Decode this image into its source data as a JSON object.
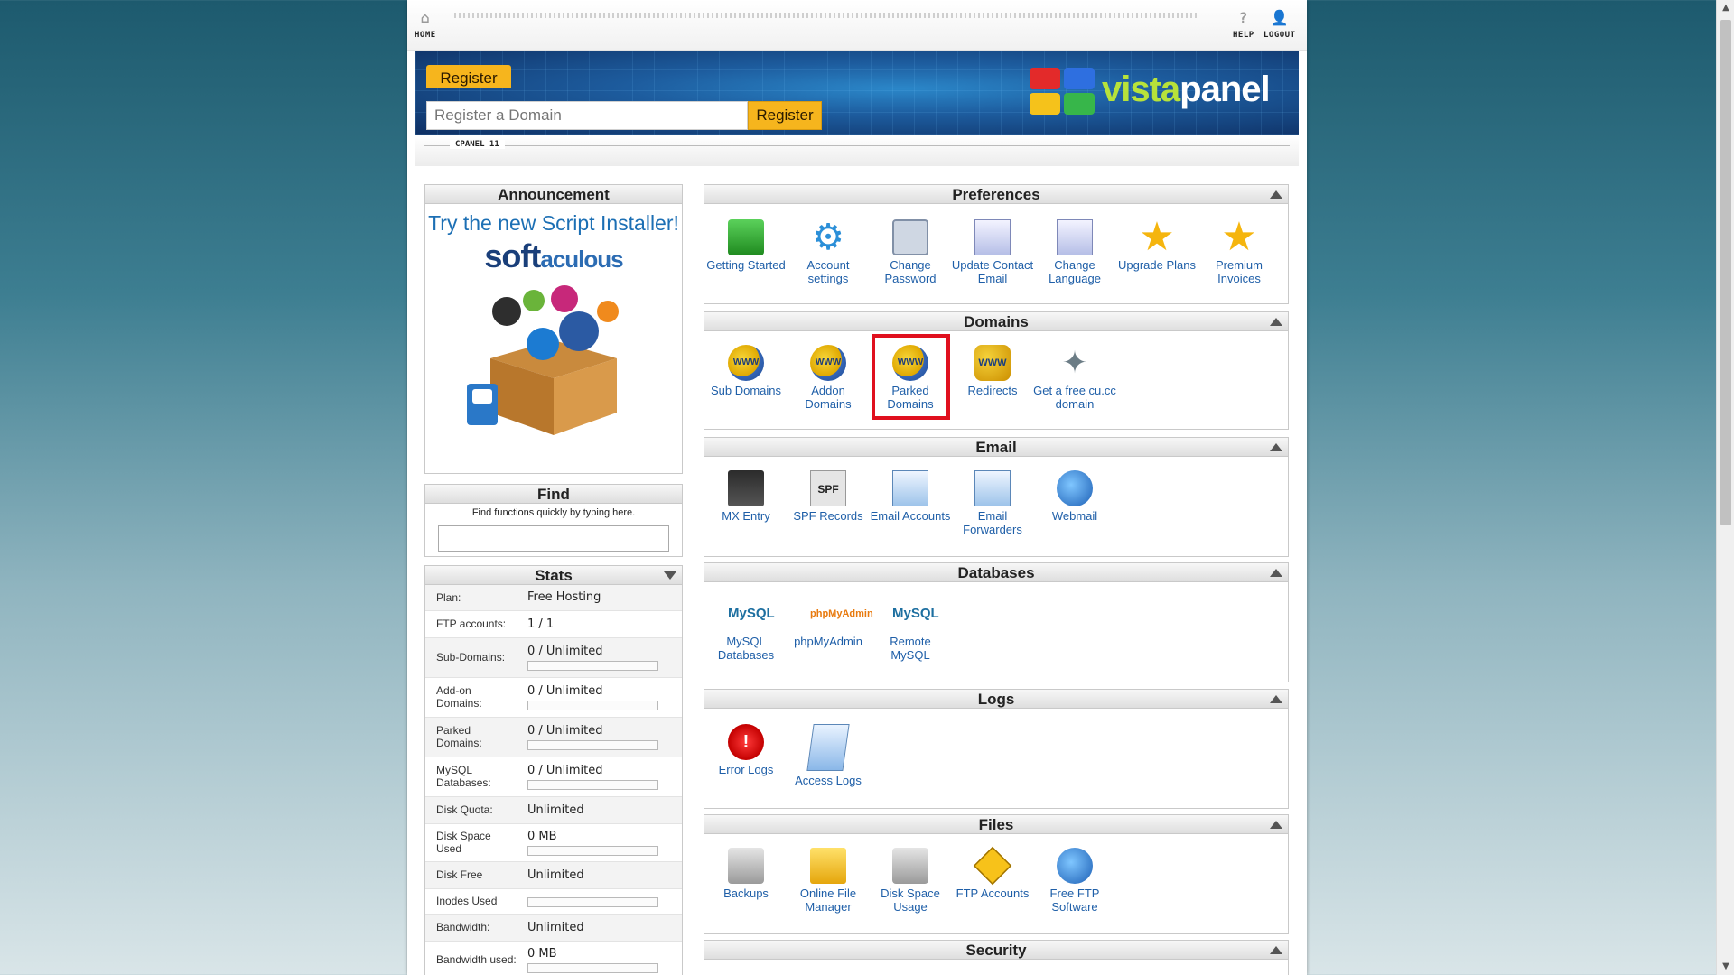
{
  "nav": {
    "home": "HOME",
    "help": "HELP",
    "logout": "LOGOUT"
  },
  "banner": {
    "register_tab": "Register",
    "domain_placeholder": "Register a Domain",
    "register_button": "Register",
    "brand_vista": "vista",
    "brand_panel": "panel"
  },
  "subbar": {
    "label": "CPANEL 11"
  },
  "announcement": {
    "title": "Announcement",
    "text": "Try the new Script Installer!",
    "logo_soft": "soft",
    "logo_aculous": "aculous"
  },
  "find": {
    "title": "Find",
    "hint": "Find functions quickly by typing here.",
    "value": ""
  },
  "stats": {
    "title": "Stats",
    "rows": [
      {
        "label": "Plan:",
        "value": "Free Hosting"
      },
      {
        "label": "FTP accounts:",
        "value": "1 / 1"
      },
      {
        "label": "Sub-Domains:",
        "value": "0 / Unlimited",
        "usage": 0
      },
      {
        "label": "Add-on Domains:",
        "value": "0 / Unlimited",
        "usage": 0
      },
      {
        "label": "Parked Domains:",
        "value": "0 / Unlimited",
        "usage": 0
      },
      {
        "label": "MySQL Databases:",
        "value": "0 / Unlimited",
        "usage": 0
      },
      {
        "label": "Disk Quota:",
        "value": "Unlimited"
      },
      {
        "label": "Disk Space Used",
        "value": "0 MB",
        "usage": 0
      },
      {
        "label": "Disk Free",
        "value": "Unlimited"
      },
      {
        "label": "Inodes Used",
        "value": "",
        "usage": 0
      },
      {
        "label": "Bandwidth:",
        "value": "Unlimited"
      },
      {
        "label": "Bandwidth used:",
        "value": "0 MB",
        "usage": 0
      }
    ]
  },
  "sections": {
    "preferences": {
      "title": "Preferences",
      "items": [
        "Getting Started",
        "Account settings",
        "Change Password",
        "Update Contact Email",
        "Change Language",
        "Upgrade Plans",
        "Premium Invoices"
      ]
    },
    "domains": {
      "title": "Domains",
      "items": [
        "Sub Domains",
        "Addon Domains",
        "Parked Domains",
        "Redirects",
        "Get a free cu.cc domain"
      ]
    },
    "email": {
      "title": "Email",
      "items": [
        "MX Entry",
        "SPF Records",
        "Email Accounts",
        "Email Forwarders",
        "Webmail"
      ]
    },
    "databases": {
      "title": "Databases",
      "items": [
        "MySQL Databases",
        "phpMyAdmin",
        "Remote MySQL"
      ]
    },
    "logs": {
      "title": "Logs",
      "items": [
        "Error Logs",
        "Access Logs"
      ]
    },
    "files": {
      "title": "Files",
      "items": [
        "Backups",
        "Online File Manager",
        "Disk Space Usage",
        "FTP Accounts",
        "Free FTP Software"
      ]
    },
    "security": {
      "title": "Security"
    }
  },
  "icon_text": {
    "spf": "SPF",
    "www": "WWW",
    "mysql": "MySQL",
    "pma": "phpMyAdmin",
    "err": "!"
  },
  "colors": {
    "link": "#1f5fa8",
    "highlight": "#e0101e",
    "accent": "#f6b51d"
  }
}
